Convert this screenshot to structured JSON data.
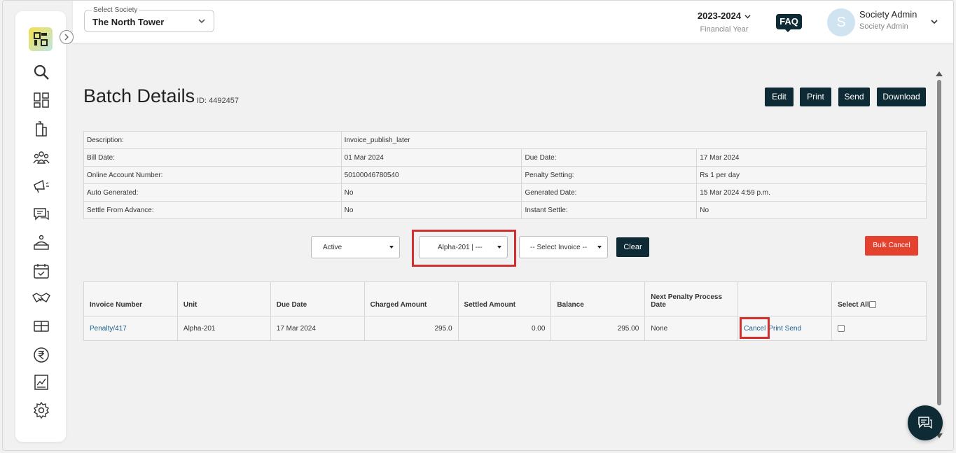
{
  "header": {
    "society_label": "Select Society",
    "society_value": "The North Tower",
    "financial_year": "2023-2024",
    "financial_year_label": "Financial Year",
    "faq": "FAQ",
    "avatar_initial": "S",
    "user_name": "Society Admin",
    "user_role": "Society Admin"
  },
  "sidebar": {
    "icons": [
      "search-icon",
      "dashboard-icon",
      "building-icon",
      "members-icon",
      "announcement-icon",
      "chat-icon",
      "helpdesk-icon",
      "calendar-icon",
      "handshake-icon",
      "amenities-icon",
      "rupee-icon",
      "reports-icon",
      "settings-icon"
    ]
  },
  "page": {
    "title": "Batch Details",
    "id_label": "ID: 4492457",
    "buttons": {
      "edit": "Edit",
      "print": "Print",
      "send": "Send",
      "download": "Download"
    }
  },
  "details": [
    {
      "label": "Description:",
      "value": "Invoice_publish_later",
      "label2": "",
      "value2": ""
    },
    {
      "label": "Bill Date:",
      "value": "01 Mar 2024",
      "label2": "Due Date:",
      "value2": "17 Mar 2024"
    },
    {
      "label": "Online Account Number:",
      "value": "50100046780540",
      "label2": "Penalty Setting:",
      "value2": "Rs 1 per day"
    },
    {
      "label": "Auto Generated:",
      "value": "No",
      "label2": "Generated Date:",
      "value2": "15 Mar 2024 4:59 p.m."
    },
    {
      "label": "Settle From Advance:",
      "value": "No",
      "label2": "Instant Settle:",
      "value2": "No"
    }
  ],
  "filters": {
    "status": "Active",
    "unit": "Alpha-201 | ---",
    "invoice": "-- Select Invoice --",
    "clear": "Clear",
    "bulk_cancel": "Bulk Cancel"
  },
  "invoice_table": {
    "headers": [
      "Invoice Number",
      "Unit",
      "Due Date",
      "Charged Amount",
      "Settled Amount",
      "Balance",
      "Next Penalty Process Date",
      "",
      "Select All"
    ],
    "rows": [
      {
        "invoice_number": "Penalty/417",
        "unit": "Alpha-201",
        "due_date": "17 Mar 2024",
        "charged": "295.0",
        "settled": "0.00",
        "balance": "295.00",
        "next_penalty": "None",
        "actions": {
          "cancel": "Cancel",
          "print": "Print",
          "send": "Send"
        }
      }
    ]
  },
  "colors": {
    "primary_dark": "#0e2a35",
    "danger": "#e5412f",
    "highlight": "#d32f2f",
    "link": "#1b5e8a"
  }
}
